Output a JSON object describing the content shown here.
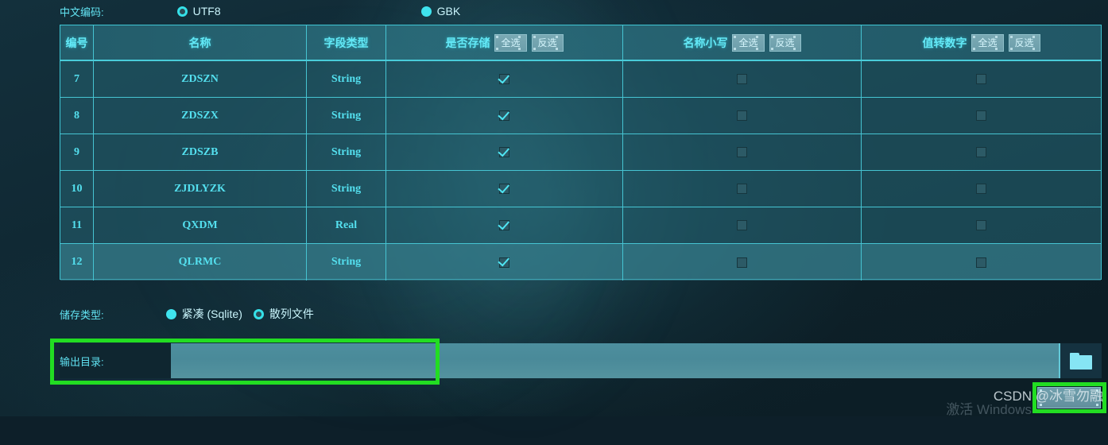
{
  "encoding": {
    "label": "中文编码:",
    "options": [
      {
        "label": "UTF8",
        "selected": false,
        "style": "ring"
      },
      {
        "label": "GBK",
        "selected": true,
        "style": "filled"
      }
    ]
  },
  "table": {
    "columns": [
      {
        "key": "id",
        "header": "编号",
        "buttons": []
      },
      {
        "key": "name",
        "header": "名称",
        "buttons": []
      },
      {
        "key": "type",
        "header": "字段类型",
        "buttons": []
      },
      {
        "key": "store",
        "header": "是否存储",
        "buttons": [
          "全选",
          "反选"
        ]
      },
      {
        "key": "lower",
        "header": "名称小写",
        "buttons": [
          "全选",
          "反选"
        ]
      },
      {
        "key": "tonum",
        "header": "值转数字",
        "buttons": [
          "全选",
          "反选"
        ]
      }
    ],
    "rows": [
      {
        "id": "7",
        "name": "ZDSZN",
        "type": "String",
        "store": true,
        "lower": false,
        "tonum": false,
        "highlight": false
      },
      {
        "id": "8",
        "name": "ZDSZX",
        "type": "String",
        "store": true,
        "lower": false,
        "tonum": false,
        "highlight": false
      },
      {
        "id": "9",
        "name": "ZDSZB",
        "type": "String",
        "store": true,
        "lower": false,
        "tonum": false,
        "highlight": false
      },
      {
        "id": "10",
        "name": "ZJDLYZK",
        "type": "String",
        "store": true,
        "lower": false,
        "tonum": false,
        "highlight": false
      },
      {
        "id": "11",
        "name": "QXDM",
        "type": "Real",
        "store": true,
        "lower": false,
        "tonum": false,
        "highlight": false
      },
      {
        "id": "12",
        "name": "QLRMC",
        "type": "String",
        "store": true,
        "lower": false,
        "tonum": false,
        "highlight": true
      }
    ]
  },
  "storage": {
    "label": "储存类型:",
    "options": [
      {
        "label": "紧凑 (Sqlite)",
        "selected": true,
        "style": "filled"
      },
      {
        "label": "散列文件",
        "selected": false,
        "style": "ring"
      }
    ]
  },
  "output": {
    "label": "输出目录:",
    "value": "",
    "placeholder": "",
    "browse_icon": "folder-icon"
  },
  "action_button": {
    "label": ""
  },
  "watermarks": {
    "csdn": "CSDN @冰雪勿融",
    "windows": "激活 Windows"
  },
  "colors": {
    "accent": "#4fe7f5",
    "border": "#46c4d2",
    "annotation": "#22dd22",
    "background": "#0d1f29",
    "table_fill": "#2b6f80"
  }
}
